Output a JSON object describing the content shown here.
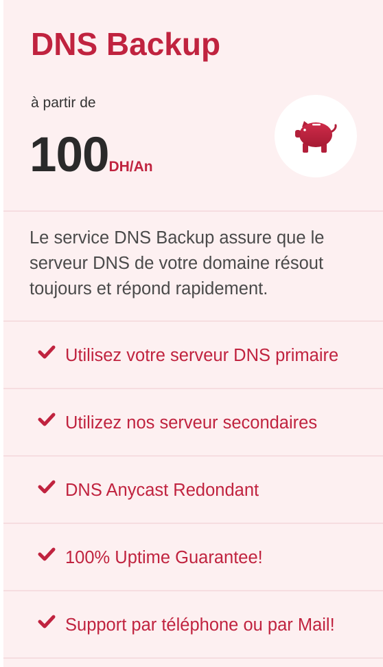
{
  "plan": {
    "title": "DNS Backup",
    "from_label": "à partir de",
    "price": "100",
    "price_unit": "DH/An",
    "icon": "piggy-bank-icon"
  },
  "description": "Le service DNS Backup assure que le serveur DNS de votre domaine résout toujours et répond rapidement.",
  "features": [
    "Utilisez votre serveur DNS primaire",
    "Utilizez nos serveur secondaires",
    "DNS Anycast Redondant",
    "100% Uptime Guarantee!",
    "Support par téléphone ou par Mail!"
  ],
  "colors": {
    "accent": "#c0233f",
    "card_background": "#fdf0f1",
    "divider": "#f6dde0",
    "price_text": "#2a2a2a",
    "body_text": "#4a4a4a"
  }
}
